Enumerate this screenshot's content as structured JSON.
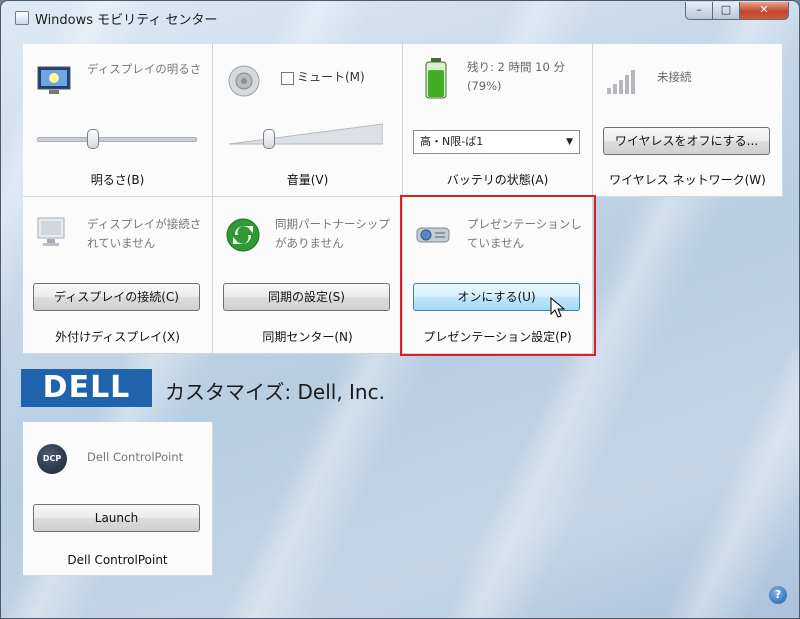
{
  "window": {
    "title": "Windows モビリティ センター",
    "minimize_glyph": "–",
    "maximize_glyph": "□",
    "close_glyph": "✕"
  },
  "tiles": {
    "brightness": {
      "desc": "ディスプレイの明るさ",
      "label": "明るさ(B)",
      "level": 0.35
    },
    "volume": {
      "mute_label": "ミュート(M)",
      "label": "音量(V)",
      "level": 0.25
    },
    "battery": {
      "desc": "残り: 2 時間 10 分 (79%)",
      "plan": "高・N限-ば1",
      "label": "バッテリの状態(A)",
      "level": 0.79
    },
    "wireless": {
      "desc": "未接続",
      "button": "ワイヤレスをオフにする...",
      "label": "ワイヤレス ネットワーク(W)"
    },
    "display": {
      "desc": "ディスプレイが接続されていません",
      "button": "ディスプレイの接続(C)",
      "label": "外付けディスプレイ(X)"
    },
    "sync": {
      "desc": "同期パートナーシップがありません",
      "button": "同期の設定(S)",
      "label": "同期センター(N)"
    },
    "presentation": {
      "desc": "プレゼンテーションしていません",
      "button": "オンにする(U)",
      "label": "プレゼンテーション設定(P)"
    }
  },
  "oem": {
    "logo": "DELL",
    "custom_text": "カスタマイズ: Dell, Inc.",
    "controlpoint": {
      "desc": "Dell ControlPoint",
      "icon_text": "DCP",
      "button": "Launch",
      "label": "Dell ControlPoint"
    }
  },
  "help_glyph": "?",
  "colors": {
    "highlight": "#e0201f",
    "dell_blue": "#1f63ad",
    "active_button": "#bee6fd"
  }
}
